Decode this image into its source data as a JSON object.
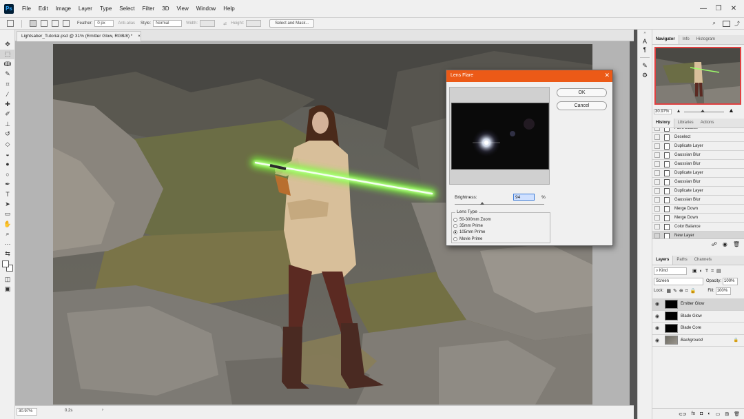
{
  "menu": {
    "logo": "Ps",
    "items": [
      "File",
      "Edit",
      "Image",
      "Layer",
      "Type",
      "Select",
      "Filter",
      "3D",
      "View",
      "Window",
      "Help"
    ],
    "window_controls": [
      "—",
      "❐",
      "✕"
    ]
  },
  "options_bar": {
    "feather_label": "Feather:",
    "feather_value": "0 px",
    "anti_alias_label": "Anti-alias",
    "style_label": "Style:",
    "style_value": "Normal",
    "width_label": "Width:",
    "height_label": "Height:",
    "select_mask_label": "Select and Mask..."
  },
  "document": {
    "tab_title": "Lightsaber_Tutorial.psd @ 31% (Emitter Glow, RGB/8) *",
    "tab_close": "×",
    "zoom": "30.97%",
    "status_info": "0.2s",
    "status_arrow": "›"
  },
  "lens_flare": {
    "title": "Lens Flare",
    "close": "✕",
    "ok_label": "OK",
    "cancel_label": "Cancel",
    "brightness_label": "Brightness:",
    "brightness_value": "94",
    "brightness_unit": "%",
    "brightness_level": 0.31,
    "lens_type_label": "Lens Type",
    "lens_types": [
      "50-300mm Zoom",
      "35mm Prime",
      "105mm Prime",
      "Movie Prime"
    ],
    "selected_lens": "105mm Prime"
  },
  "navigator": {
    "tabs": [
      "Navigator",
      "Info",
      "Histogram"
    ],
    "zoom": "30.97%"
  },
  "history": {
    "tabs": [
      "History",
      "Libraries",
      "Actions"
    ],
    "items": [
      "Paint Bucket",
      "Deselect",
      "Duplicate Layer",
      "Gaussian Blur",
      "Gaussian Blur",
      "Duplicate Layer",
      "Gaussian Blur",
      "Duplicate Layer",
      "Gaussian Blur",
      "Merge Down",
      "Merge Down",
      "Color Balance",
      "New Layer"
    ],
    "active_index": 12
  },
  "layers": {
    "tabs": [
      "Layers",
      "Paths",
      "Channels"
    ],
    "kind_label": "Kind",
    "blend_mode": "Screen",
    "opacity_label": "Opacity:",
    "opacity_value": "100%",
    "lock_label": "Lock:",
    "fill_label": "Fill:",
    "fill_value": "100%",
    "items": [
      {
        "name": "Emitter Glow",
        "selected": true
      },
      {
        "name": "Blade Glow",
        "selected": false
      },
      {
        "name": "Blade Core",
        "selected": false
      },
      {
        "name": "Background",
        "selected": false
      }
    ]
  },
  "colors": {
    "dialog_title_bar": "#ec5a17",
    "selection": "#d5d5d5",
    "saber_glow": "#7dff3a"
  }
}
